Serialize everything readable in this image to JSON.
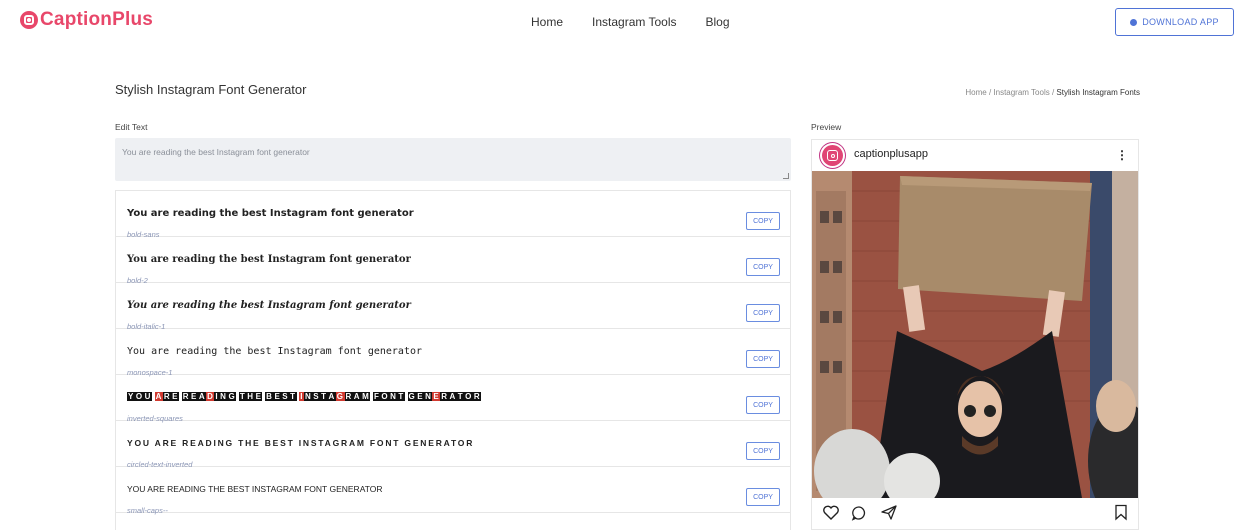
{
  "brand": {
    "name": "CaptionPlus"
  },
  "nav": {
    "items": [
      "Home",
      "Instagram Tools",
      "Blog"
    ]
  },
  "header": {
    "download_label": "DOWNLOAD APP"
  },
  "page": {
    "title": "Stylish Instagram Font Generator",
    "breadcrumb": [
      "Home",
      "Instagram Tools",
      "Stylish Instagram Fonts"
    ]
  },
  "editor": {
    "label": "Edit Text",
    "placeholder": "You are reading the best Instagram font generator"
  },
  "results": {
    "copy_label": "COPY",
    "rows": [
      {
        "text": "You are reading the best Instagram font generator",
        "style": "bold-sans"
      },
      {
        "text": "You are reading the best Instagram font generator",
        "style": "bold-2"
      },
      {
        "text": "You are reading the best Instagram font generator",
        "style": "bold-italic-1"
      },
      {
        "text": "You are reading the best Instagram font generator",
        "style": "monospace-1"
      },
      {
        "text": "YOU ARE READING THE BEST INSTAGRAM FONT GENERATOR",
        "style": "inverted-squares"
      },
      {
        "text": "YOU ARE READING THE BEST INSTAGRAM FONT GENERATOR",
        "style": "circled-text-inverted"
      },
      {
        "text": "YOU ARE READING THE BEST INSTAGRAM FONT GENERATOR",
        "style": "small-caps--"
      }
    ]
  },
  "preview": {
    "label": "Preview",
    "username": "captionplusapp",
    "icons": [
      "heart-icon",
      "comment-icon",
      "share-icon",
      "bookmark-icon"
    ]
  },
  "colors": {
    "brand": "#e8476a",
    "accent": "#4f73d6"
  }
}
